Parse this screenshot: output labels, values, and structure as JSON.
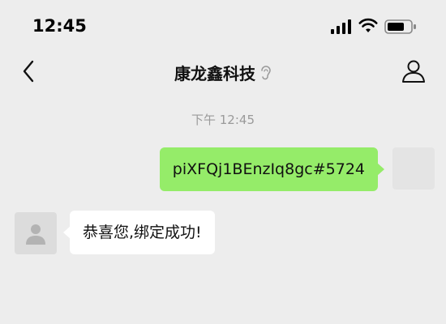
{
  "status_bar": {
    "time": "12:45",
    "icons": [
      "signal-icon",
      "wifi-icon",
      "battery-icon"
    ]
  },
  "nav": {
    "back_icon": "chevron-left-icon",
    "title": "康龙鑫科技",
    "mute_icon": "ear-icon",
    "profile_icon": "person-icon"
  },
  "chat": {
    "timestamp": "下午 12:45",
    "messages": [
      {
        "direction": "sent",
        "text": "piXFQj1BEnzIq8gc#5724"
      },
      {
        "direction": "received",
        "text": "恭喜您,绑定成功!"
      }
    ]
  },
  "colors": {
    "background": "#ededed",
    "sent_bubble": "#95ec69",
    "received_bubble": "#ffffff",
    "timestamp_text": "#9a9a9a"
  }
}
